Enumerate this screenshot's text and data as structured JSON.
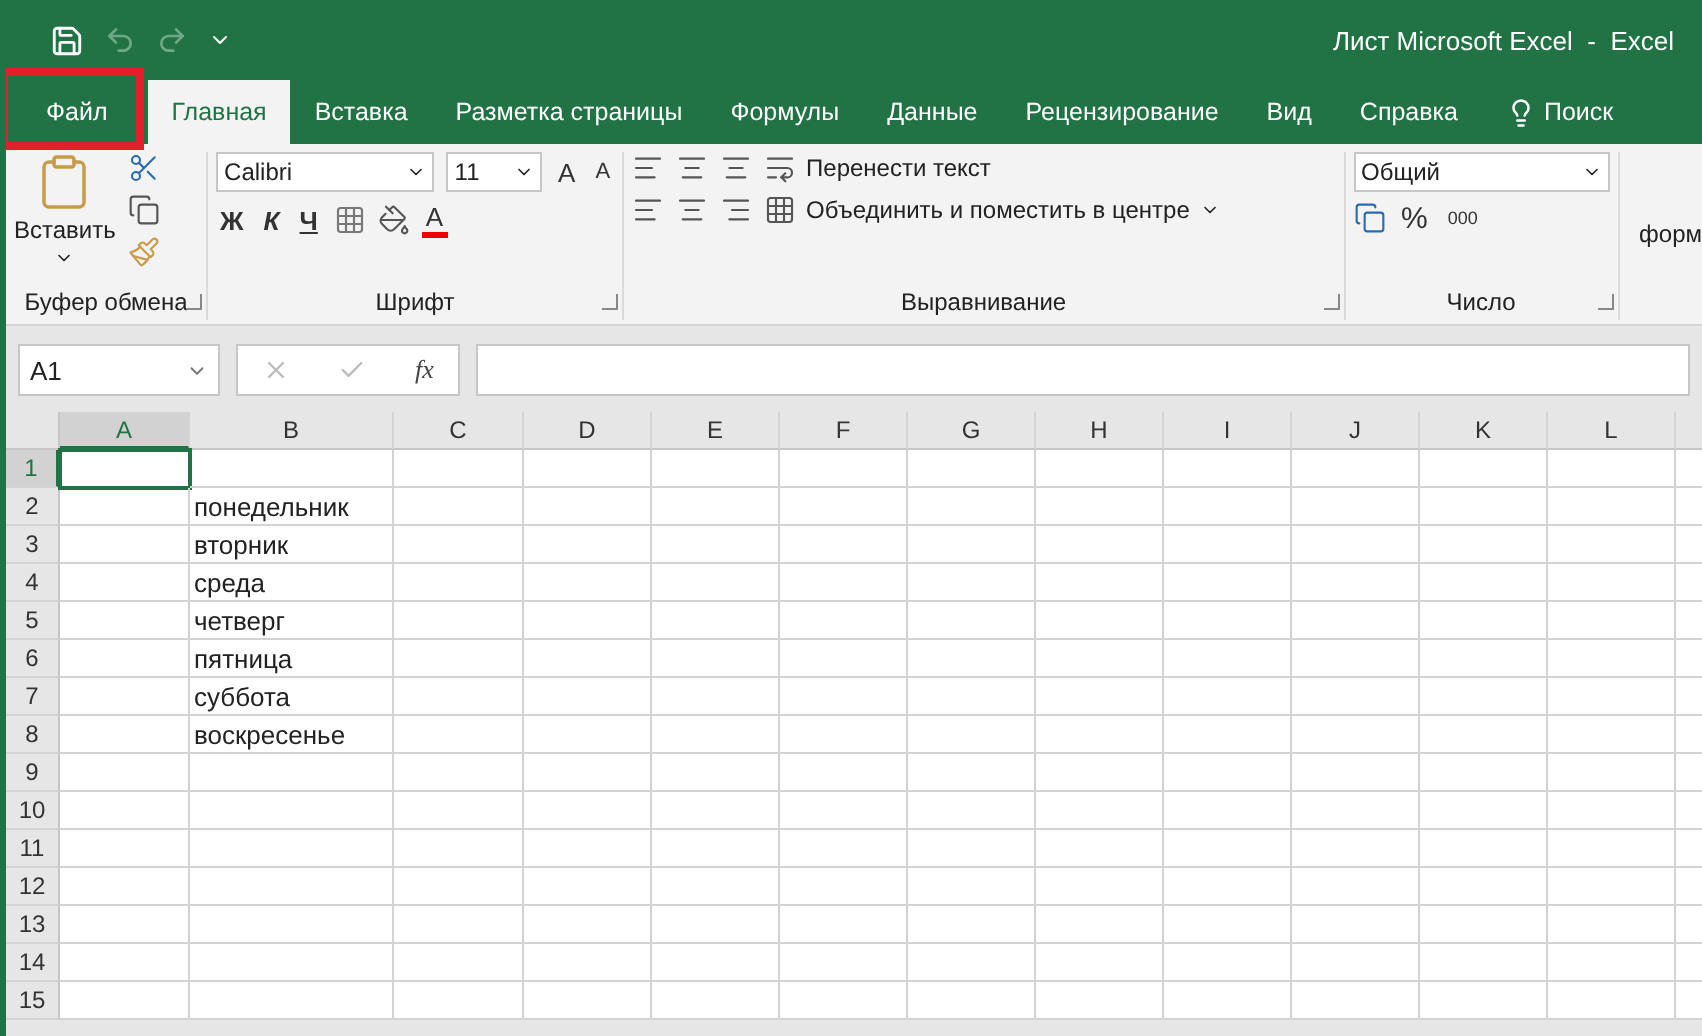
{
  "title_bar": {
    "title": "Лист Microsoft Excel  -  Excel"
  },
  "tabs": [
    {
      "label": "Файл",
      "selected": false,
      "highlighted": true,
      "kind": "file"
    },
    {
      "label": "Главная",
      "selected": true,
      "highlighted": false,
      "kind": "tab"
    },
    {
      "label": "Вставка",
      "selected": false,
      "highlighted": false,
      "kind": "tab"
    },
    {
      "label": "Разметка страницы",
      "selected": false,
      "highlighted": false,
      "kind": "tab"
    },
    {
      "label": "Формулы",
      "selected": false,
      "highlighted": false,
      "kind": "tab"
    },
    {
      "label": "Данные",
      "selected": false,
      "highlighted": false,
      "kind": "tab"
    },
    {
      "label": "Рецензирование",
      "selected": false,
      "highlighted": false,
      "kind": "tab"
    },
    {
      "label": "Вид",
      "selected": false,
      "highlighted": false,
      "kind": "tab"
    },
    {
      "label": "Справка",
      "selected": false,
      "highlighted": false,
      "kind": "tab"
    },
    {
      "label": "Поиск",
      "selected": false,
      "highlighted": false,
      "kind": "search"
    }
  ],
  "ribbon": {
    "clipboard": {
      "paste": "Вставить",
      "label": "Буфер обмена"
    },
    "font": {
      "font_name": "Calibri",
      "font_size": "11",
      "grow": "A",
      "shrink": "A",
      "bold": "Ж",
      "italic": "К",
      "underline": "Ч",
      "font_color": "A",
      "label": "Шрифт"
    },
    "alignment": {
      "wrap_text": "Перенести текст",
      "merge_center": "Объединить и поместить в центре",
      "label": "Выравнивание"
    },
    "number": {
      "format": "Общий",
      "percent": "%",
      "thousands": "000",
      "label": "Число"
    },
    "next_group": "форм"
  },
  "formula_bar": {
    "name_box": "A1",
    "function_label": "fx"
  },
  "sheet": {
    "columns": [
      {
        "label": "A",
        "selected": true
      },
      {
        "label": "B",
        "selected": false
      },
      {
        "label": "C",
        "selected": false
      },
      {
        "label": "D",
        "selected": false
      },
      {
        "label": "E",
        "selected": false
      },
      {
        "label": "F",
        "selected": false
      },
      {
        "label": "G",
        "selected": false
      },
      {
        "label": "H",
        "selected": false
      },
      {
        "label": "I",
        "selected": false
      },
      {
        "label": "J",
        "selected": false
      },
      {
        "label": "K",
        "selected": false
      },
      {
        "label": "L",
        "selected": false
      }
    ],
    "rows": [
      {
        "number": "1",
        "selected": true,
        "cells": {}
      },
      {
        "number": "2",
        "selected": false,
        "cells": {
          "B": "понедельник"
        }
      },
      {
        "number": "3",
        "selected": false,
        "cells": {
          "B": "вторник"
        }
      },
      {
        "number": "4",
        "selected": false,
        "cells": {
          "B": "среда"
        }
      },
      {
        "number": "5",
        "selected": false,
        "cells": {
          "B": "четверг"
        }
      },
      {
        "number": "6",
        "selected": false,
        "cells": {
          "B": "пятница"
        }
      },
      {
        "number": "7",
        "selected": false,
        "cells": {
          "B": "суббота"
        }
      },
      {
        "number": "8",
        "selected": false,
        "cells": {
          "B": "воскресенье"
        }
      },
      {
        "number": "9",
        "selected": false,
        "cells": {}
      },
      {
        "number": "10",
        "selected": false,
        "cells": {}
      },
      {
        "number": "11",
        "selected": false,
        "cells": {}
      },
      {
        "number": "12",
        "selected": false,
        "cells": {}
      },
      {
        "number": "13",
        "selected": false,
        "cells": {}
      },
      {
        "number": "14",
        "selected": false,
        "cells": {}
      },
      {
        "number": "15",
        "selected": false,
        "cells": {}
      }
    ]
  }
}
